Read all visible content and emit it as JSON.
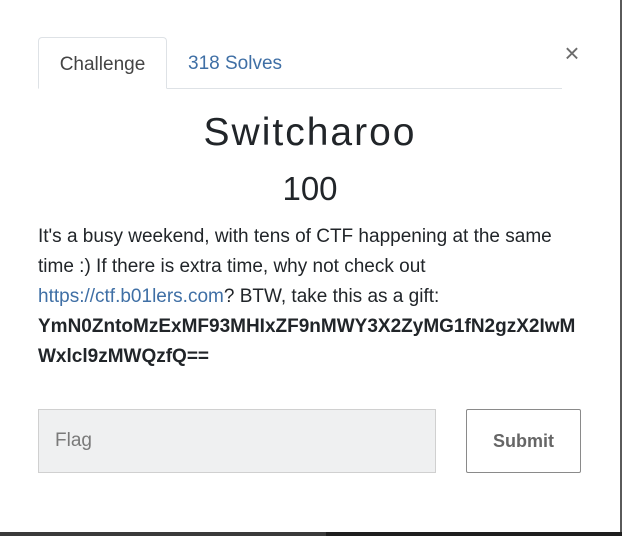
{
  "modal": {
    "close_symbol": "×",
    "tabs": [
      {
        "label": "Challenge",
        "active": true
      },
      {
        "label": "318 Solves",
        "active": false
      }
    ],
    "challenge": {
      "name": "Switcharoo",
      "points": "100",
      "description_part1": "It's a busy weekend, with tens of CTF happening at the same time :) If there is extra time, why not check out ",
      "link_text": "https://ctf.b01lers.com",
      "description_part2": "? BTW, take this as a gift:",
      "gift": "YmN0ZntoMzExMF93MHIxZF9nMWY3X2ZyMG1fN2gzX2IwMWxlcl9zMWQzfQ=="
    },
    "form": {
      "flag_placeholder": "Flag",
      "flag_value": "",
      "submit_label": "Submit"
    }
  },
  "colors": {
    "link": "#3f6fa5",
    "input_bg": "#eff0f1",
    "text": "#212529"
  },
  "icons": {
    "close": "close-icon"
  }
}
